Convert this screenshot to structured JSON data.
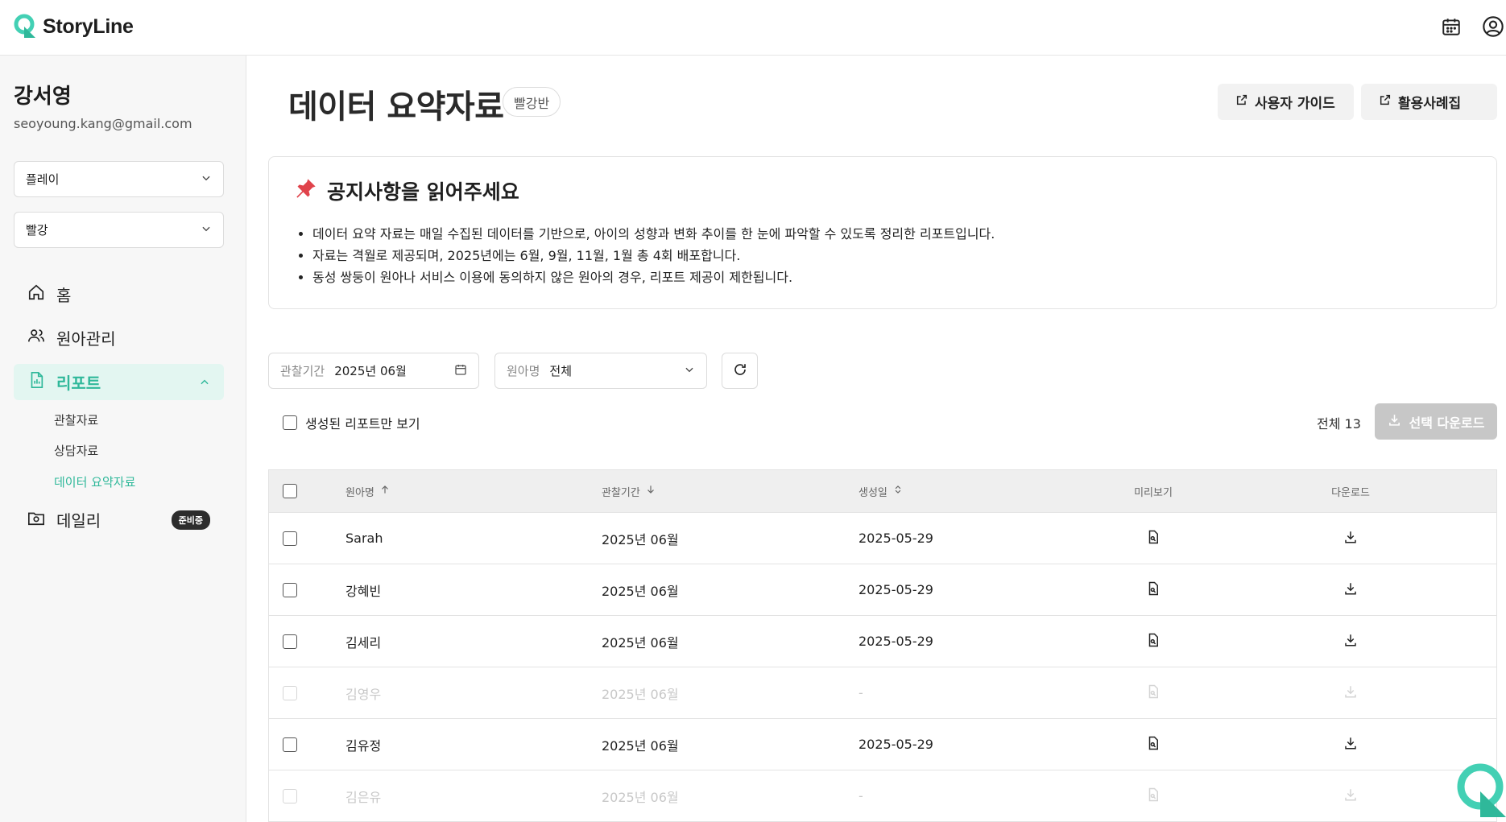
{
  "header": {
    "logo_text": "StoryLine",
    "icons": [
      "calendar-icon",
      "user-circle-icon"
    ],
    "accent_color": "#2fb89a"
  },
  "sidebar": {
    "user_name": "강서영",
    "user_email": "seoyoung.kang@gmail.com",
    "select_1": "플레이",
    "select_2": "빨강",
    "nav": {
      "home": "홈",
      "children": "원아관리",
      "report": "리포트",
      "sub_observation": "관찰자료",
      "sub_counsel": "상담자료",
      "sub_summary": "데이터 요약자료",
      "daily": "데일리",
      "daily_badge": "준비중"
    }
  },
  "main": {
    "title": "데이터 요약자료",
    "class_chip": "빨강반",
    "guide_button": "사용자 가이드",
    "cases_button": "활용사례집",
    "notice": {
      "title": "공지사항을 읽어주세요",
      "items": [
        "데이터 요약 자료는 매일 수집된 데이터를 기반으로, 아이의 성향과 변화 추이를 한 눈에 파악할 수 있도록 정리한 리포트입니다.",
        "자료는 격월로 제공되며, 2025년에는 6월, 9월, 11월, 1월 총 4회 배포합니다.",
        "동성 쌍둥이 원아나 서비스 이용에 동의하지 않은 원아의 경우, 리포트 제공이 제한됩니다."
      ]
    },
    "filters": {
      "period_label": "관찰기간",
      "period_value": "2025년 06월",
      "child_label": "원아명",
      "child_value": "전체"
    },
    "only_generated_label": "생성된 리포트만 보기",
    "total_label": "전체 13",
    "download_selected": "선택 다운로드",
    "table": {
      "headers": {
        "name": "원아명",
        "period": "관찰기간",
        "created": "생성일",
        "preview": "미리보기",
        "download": "다운로드"
      },
      "rows": [
        {
          "name": "Sarah",
          "period": "2025년 06월",
          "created": "2025-05-29",
          "available": true
        },
        {
          "name": "강혜빈",
          "period": "2025년 06월",
          "created": "2025-05-29",
          "available": true
        },
        {
          "name": "김세리",
          "period": "2025년 06월",
          "created": "2025-05-29",
          "available": true
        },
        {
          "name": "김영우",
          "period": "2025년 06월",
          "created": "-",
          "available": false
        },
        {
          "name": "김유정",
          "period": "2025년 06월",
          "created": "2025-05-29",
          "available": true
        },
        {
          "name": "김은유",
          "period": "2025년 06월",
          "created": "-",
          "available": false
        }
      ]
    }
  }
}
